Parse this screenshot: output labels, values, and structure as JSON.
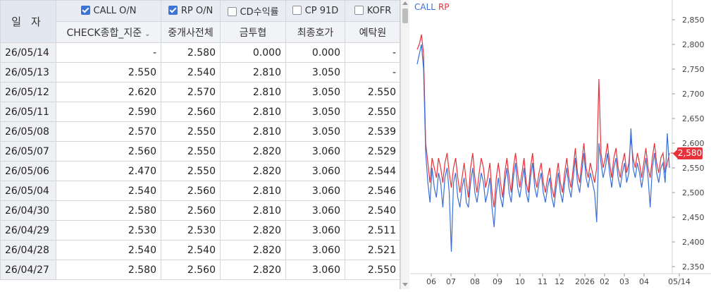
{
  "table": {
    "date_header": "일자",
    "groups": [
      {
        "label": "CALL O/N",
        "checked": true
      },
      {
        "label": "RP O/N",
        "checked": true
      },
      {
        "label": "CD수익률",
        "checked": false
      },
      {
        "label": "CP 91D",
        "checked": false
      },
      {
        "label": "KOFR",
        "checked": false
      }
    ],
    "sub_headers": [
      "CHECK종합_지준",
      "중개사전체",
      "금투협",
      "최종호가",
      "예탁원"
    ],
    "rows": [
      [
        "26/05/14",
        "-",
        "2.580",
        "0.000",
        "0.000",
        "-"
      ],
      [
        "26/05/13",
        "2.550",
        "2.540",
        "2.810",
        "3.050",
        "-"
      ],
      [
        "26/05/12",
        "2.620",
        "2.570",
        "2.810",
        "3.050",
        "2.550"
      ],
      [
        "26/05/11",
        "2.590",
        "2.560",
        "2.810",
        "3.050",
        "2.550"
      ],
      [
        "26/05/08",
        "2.570",
        "2.550",
        "2.810",
        "3.050",
        "2.539"
      ],
      [
        "26/05/07",
        "2.560",
        "2.550",
        "2.820",
        "3.060",
        "2.529"
      ],
      [
        "26/05/06",
        "2.470",
        "2.550",
        "2.820",
        "3.060",
        "2.544"
      ],
      [
        "26/05/04",
        "2.540",
        "2.560",
        "2.810",
        "3.060",
        "2.546"
      ],
      [
        "26/04/30",
        "2.580",
        "2.560",
        "2.810",
        "3.060",
        "2.540"
      ],
      [
        "26/04/29",
        "2.530",
        "2.530",
        "2.820",
        "3.060",
        "2.511"
      ],
      [
        "26/04/28",
        "2.540",
        "2.540",
        "2.820",
        "3.060",
        "2.521"
      ],
      [
        "26/04/27",
        "2.580",
        "2.560",
        "2.820",
        "3.060",
        "2.550"
      ]
    ]
  },
  "chart_data": {
    "type": "line",
    "legend": [
      {
        "name": "CALL",
        "color": "#3a6fd8"
      },
      {
        "name": "RP",
        "color": "#e8323a"
      }
    ],
    "y_ticks": [
      "2,850",
      "2,800",
      "2,750",
      "2,700",
      "2,650",
      "2,600",
      "2,550",
      "2,500",
      "2,450",
      "2,400",
      "2,350"
    ],
    "ylim": [
      2.33,
      2.87
    ],
    "x_ticks": [
      "06",
      "07",
      "08",
      "09",
      "10",
      "11",
      "12",
      "2026",
      "02",
      "03",
      "04",
      "05/14"
    ],
    "current_value_label": "2,580",
    "current_value": 2.58,
    "series": [
      {
        "name": "RP",
        "color": "#e8323a",
        "values": [
          2.79,
          2.8,
          2.82,
          2.78,
          2.6,
          2.56,
          2.52,
          2.57,
          2.55,
          2.53,
          2.57,
          2.55,
          2.52,
          2.56,
          2.58,
          2.54,
          2.51,
          2.55,
          2.57,
          2.53,
          2.5,
          2.53,
          2.56,
          2.52,
          2.49,
          2.55,
          2.58,
          2.53,
          2.5,
          2.54,
          2.57,
          2.55,
          2.51,
          2.53,
          2.56,
          2.5,
          2.47,
          2.53,
          2.56,
          2.52,
          2.49,
          2.54,
          2.57,
          2.53,
          2.5,
          2.55,
          2.58,
          2.54,
          2.51,
          2.54,
          2.57,
          2.52,
          2.5,
          2.55,
          2.58,
          2.53,
          2.51,
          2.54,
          2.56,
          2.52,
          2.5,
          2.53,
          2.55,
          2.51,
          2.49,
          2.53,
          2.56,
          2.52,
          2.5,
          2.54,
          2.57,
          2.53,
          2.51,
          2.55,
          2.59,
          2.54,
          2.52,
          2.56,
          2.6,
          2.55,
          2.53,
          2.56,
          2.54,
          2.52,
          2.55,
          2.73,
          2.58,
          2.55,
          2.57,
          2.6,
          2.56,
          2.53,
          2.57,
          2.59,
          2.55,
          2.53,
          2.56,
          2.58,
          2.54,
          2.56,
          2.61,
          2.57,
          2.55,
          2.58,
          2.56,
          2.53,
          2.56,
          2.59,
          2.55,
          2.53,
          2.57,
          2.6,
          2.56,
          2.54,
          2.57,
          2.58,
          2.54,
          2.56,
          2.58
        ]
      },
      {
        "name": "CALL",
        "color": "#3a6fd8",
        "values": [
          2.76,
          2.78,
          2.8,
          2.75,
          2.58,
          2.52,
          2.48,
          2.55,
          2.51,
          2.49,
          2.54,
          2.52,
          2.47,
          2.53,
          2.55,
          2.5,
          2.38,
          2.52,
          2.54,
          2.49,
          2.47,
          2.51,
          2.53,
          2.48,
          2.47,
          2.52,
          2.55,
          2.5,
          2.48,
          2.51,
          2.54,
          2.52,
          2.48,
          2.5,
          2.53,
          2.47,
          2.43,
          2.5,
          2.53,
          2.49,
          2.47,
          2.52,
          2.55,
          2.5,
          2.48,
          2.53,
          2.56,
          2.51,
          2.49,
          2.52,
          2.55,
          2.5,
          2.48,
          2.53,
          2.56,
          2.51,
          2.49,
          2.52,
          2.54,
          2.5,
          2.48,
          2.51,
          2.53,
          2.49,
          2.47,
          2.51,
          2.54,
          2.5,
          2.48,
          2.52,
          2.55,
          2.51,
          2.49,
          2.53,
          2.57,
          2.52,
          2.5,
          2.54,
          2.58,
          2.53,
          2.51,
          2.54,
          2.52,
          2.5,
          2.44,
          2.6,
          2.56,
          2.53,
          2.55,
          2.58,
          2.54,
          2.51,
          2.55,
          2.57,
          2.53,
          2.51,
          2.54,
          2.56,
          2.52,
          2.54,
          2.63,
          2.55,
          2.53,
          2.56,
          2.54,
          2.51,
          2.54,
          2.57,
          2.53,
          2.47,
          2.55,
          2.58,
          2.54,
          2.52,
          2.55,
          2.56,
          2.52,
          2.62,
          2.55
        ]
      }
    ]
  }
}
